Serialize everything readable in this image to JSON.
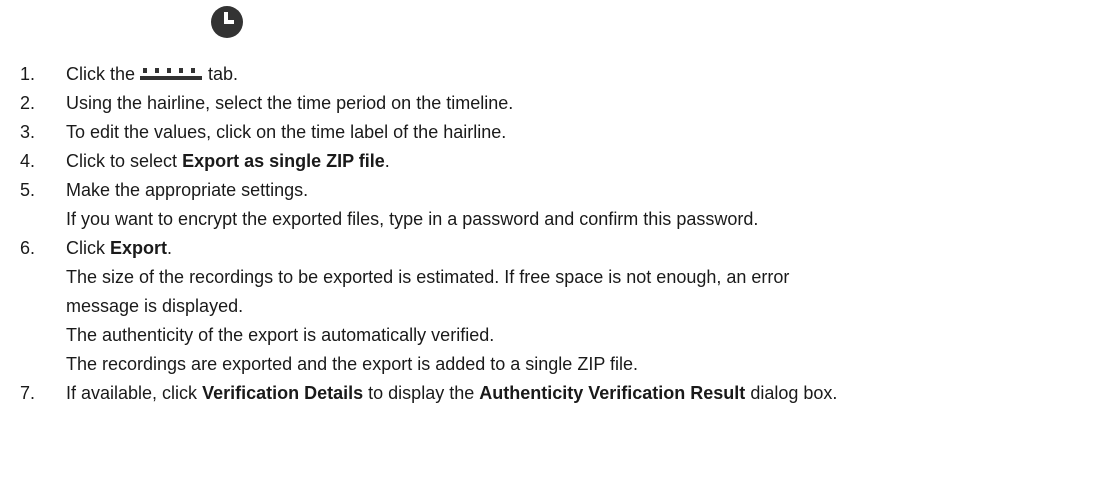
{
  "steps": [
    {
      "num": "1.",
      "before_icon": "Click the",
      "icon": "timeline-ruler-icon",
      "after_icon": "tab.",
      "tab_icon": "clock-icon"
    },
    {
      "num": "2.",
      "text": "Using the hairline, select the time period on the timeline."
    },
    {
      "num": "3.",
      "text": "To edit the values, click on the time label of the hairline."
    },
    {
      "num": "4.",
      "before": "Click to select",
      "bold": "Export as single ZIP file",
      "after": "."
    },
    {
      "num": "5.",
      "text": "Make the appropriate settings.",
      "cont": [
        "If you want to encrypt the exported files, type in a password and confirm this password."
      ]
    },
    {
      "num": "6.",
      "before": "Click",
      "bold": "Export",
      "after": ".",
      "cont": [
        "The size of the recordings to be exported is estimated. If free space is not enough, an error",
        "message is displayed.",
        "The authenticity of the export is automatically verified.",
        "The recordings are exported and the export is added to a single ZIP file."
      ]
    },
    {
      "num": "7.",
      "before": "If available, click",
      "bold": "Verification Details",
      "middle": "to display the",
      "bold2": "Authenticity Verification Result",
      "after": "dialog box."
    }
  ],
  "colors": {
    "text": "#1a1a1a",
    "icon": "#333333"
  }
}
